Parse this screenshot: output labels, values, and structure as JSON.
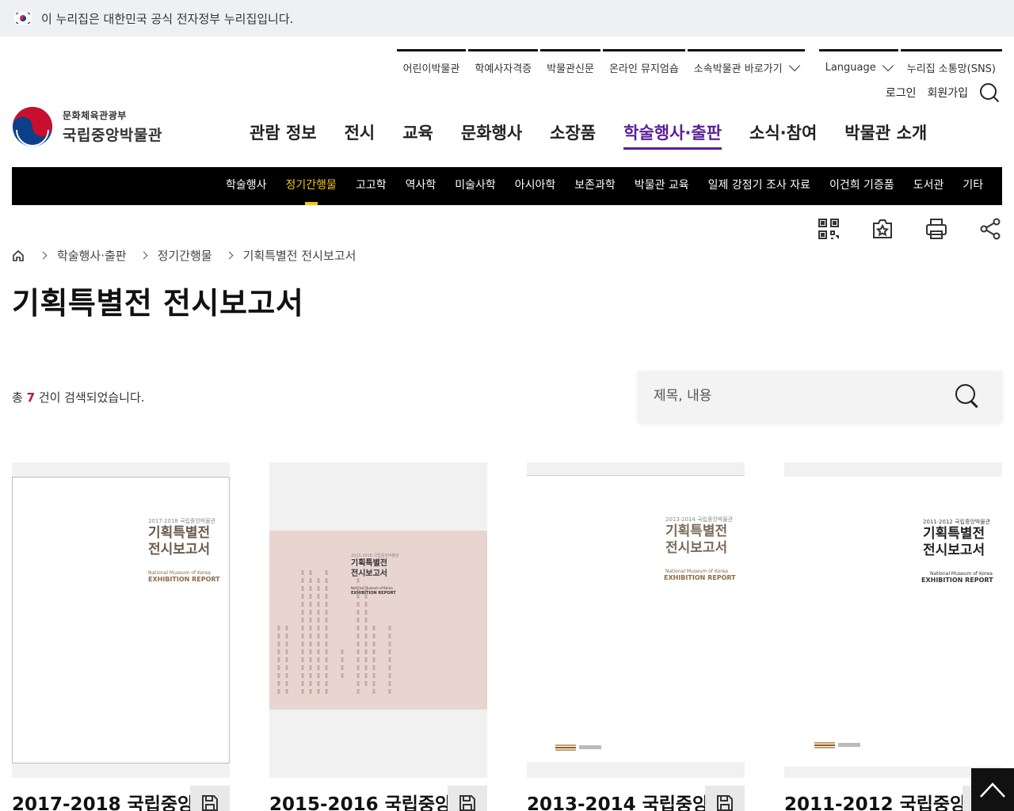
{
  "gov_banner": {
    "text": "이 누리집은 대한민국 공식 전자정부 누리집입니다."
  },
  "util_nav": {
    "items": [
      "어린이박물관",
      "학예사자격증",
      "박물관신문",
      "온라인 뮤지엄숍",
      "소속박물관 바로가기",
      "Language",
      "누리집 소통망(SNS)"
    ],
    "login": "로그인",
    "signup": "회원가입"
  },
  "logo": {
    "ministry": "문화체육관광부",
    "museum": "국립중앙박물관"
  },
  "gnb": [
    "관람 정보",
    "전시",
    "교육",
    "문화행사",
    "소장품",
    "학술행사·출판",
    "소식·참여",
    "박물관 소개"
  ],
  "subnav": [
    "학술행사",
    "정기간행물",
    "고고학",
    "역사학",
    "미술사학",
    "아시아학",
    "보존과학",
    "박물관 교육",
    "일제 강점기 조사 자료",
    "이건희 기증품",
    "도서관",
    "기타"
  ],
  "breadcrumb": [
    "학술행사·출판",
    "정기간행물",
    "기획특별전 전시보고서"
  ],
  "page_title": "기획특별전 전시보고서",
  "result": {
    "prefix": "총",
    "count": "7",
    "suffix": "건이 검색되었습니다."
  },
  "search": {
    "placeholder": "제목, 내용"
  },
  "cards": [
    {
      "title": "2017-2018 국립중앙",
      "cover_year": "2017·2018 국립중앙박물관",
      "cover_title1": "기획특별전",
      "cover_title2": "전시보고서",
      "cover_en1": "National Museum of Korea",
      "cover_en2": "EXHIBITION REPORT"
    },
    {
      "title": "2015-2016 국립중앙",
      "cover_year": "2015·2016 국립중앙박물관",
      "cover_title1": "기획특별전",
      "cover_title2": "전시보고서",
      "cover_en1": "National Museum of Korea",
      "cover_en2": "EXHIBITION REPORT"
    },
    {
      "title": "2013-2014 국립중앙",
      "cover_year": "2013·2014 국립중앙박물관",
      "cover_title1": "기획특별전",
      "cover_title2": "전시보고서",
      "cover_en1": "National Museum of Korea",
      "cover_en2": "EXHIBITION REPORT"
    },
    {
      "title": "2011-2012 국립중앙",
      "cover_year": "2011·2012 국립중앙박물관",
      "cover_title1": "기획특별전",
      "cover_title2": "전시보고서",
      "cover_en1": "National Museum of Korea",
      "cover_en2": "EXHIBITION REPORT"
    }
  ],
  "colors": {
    "accent": "#5a1f96",
    "subnav_active": "#f5c518",
    "count": "#b8124e"
  }
}
